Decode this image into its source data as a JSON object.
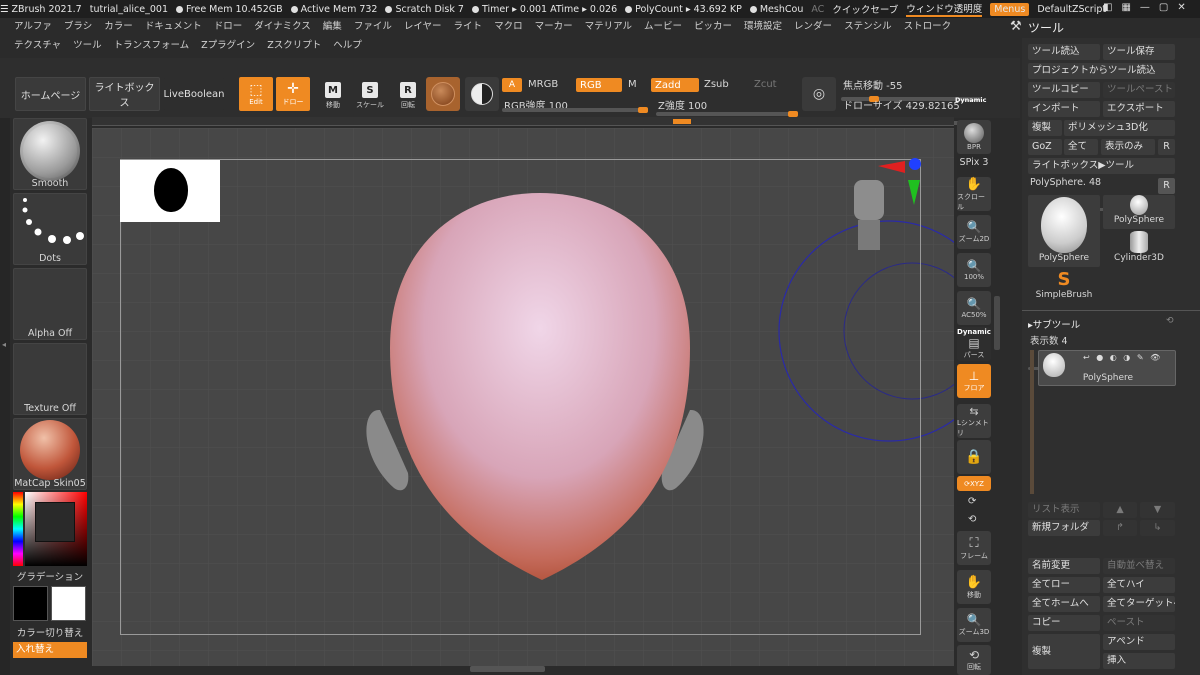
{
  "titlebar": {
    "app": "ZBrush 2021.7",
    "file": "tutrial_alice_001",
    "free_mem": "Free Mem 10.452GB",
    "active_mem": "Active Mem 732",
    "scratch": "Scratch Disk 7",
    "timer": "Timer ▸ 0.001 ATime ▸ 0.026",
    "polycount": "PolyCount ▸ 43.692 KP",
    "meshcount": "MeshCou",
    "ac": "AC",
    "quicksave": "クイックセーブ",
    "transparency": "ウィンドウ透明度",
    "menus": "Menus",
    "zscript": "DefaultZScript"
  },
  "menus_row1": [
    "アルファ",
    "ブラシ",
    "カラー",
    "ドキュメント",
    "ドロー",
    "ダイナミクス",
    "編集",
    "ファイル",
    "レイヤー",
    "ライト",
    "マクロ",
    "マーカー",
    "マテリアル",
    "ムービー",
    "ピッカー",
    "環境設定",
    "レンダー",
    "ステンシル",
    "ストローク"
  ],
  "menus_row2": [
    "テクスチャ",
    "ツール",
    "トランスフォーム",
    "Zプラグイン",
    "Zスクリプト",
    "ヘルプ"
  ],
  "shelf": {
    "home": "ホームページ",
    "lightbox": "ライトボックス",
    "liveboolean": "LiveBoolean",
    "edit": "Edit",
    "draw": "ドロー",
    "move": "移動",
    "scale": "スケール",
    "rotate": "回転",
    "a": "A",
    "mrgb": "MRGB",
    "rgb": "RGB",
    "m": "M",
    "zadd": "Zadd",
    "zsub": "Zsub",
    "zcut": "Zcut",
    "rgb_intensity": "RGB強度 100",
    "z_intensity": "Z強度 100",
    "focal_shift": "焦点移動 -55",
    "draw_size": "ドローサイズ 429.82165",
    "dynamic": "Dynamic"
  },
  "left_tray": {
    "brush": "Smooth",
    "stroke": "Dots",
    "alpha": "Alpha Off",
    "texture": "Texture Off",
    "material": "MatCap Skin05",
    "gradient": "グラデーション",
    "switch_color": "カラー切り替え",
    "swap": "入れ替え"
  },
  "right_column": {
    "bpr": "BPR",
    "spix": "SPix 3",
    "scroll": "スクロール",
    "zoom2d": "ズーム2D",
    "pct100": "100%",
    "ac50": "AC50%",
    "dynamic": "Dynamic",
    "perspective": "パース",
    "floor": "フロア",
    "symmetry_local": "Lシンメトリ",
    "xyz": "XYZ",
    "frame": "フレーム",
    "move": "移動",
    "zoom3d": "ズーム3D",
    "rotate": "回転"
  },
  "tool_panel": {
    "title": "ツール",
    "load": "ツール読込",
    "save": "ツール保存",
    "load_project": "プロジェクトからツール読込",
    "copy": "ツールコピー",
    "paste": "ツールペースト",
    "import": "インポート",
    "export": "エクスポート",
    "clone": "複製",
    "polymesh": "ポリメッシュ3D化",
    "goz": "GoZ",
    "all": "全て",
    "visible": "表示のみ",
    "r": "R",
    "lightbox_tool": "ライトボックス▶ツール",
    "polysphere_value": "PolySphere. 48",
    "thumb_main": "PolySphere",
    "thumb_polysphere": "PolySphere",
    "thumb_cylinder": "Cylinder3D",
    "thumb_simplebrush": "SimpleBrush"
  },
  "subtool_panel": {
    "title": "▸サブツール",
    "count": "表示数 4",
    "item": "PolySphere",
    "list_view": "リスト表示",
    "new_folder": "新規フォルダ",
    "rename": "名前変更",
    "autosort": "自動並べ替え",
    "all_low": "全てロー",
    "all_high": "全てハイ",
    "all_home": "全てホームへ",
    "all_target": "全てターゲットへ",
    "copy": "コピー",
    "paste": "ペースト",
    "duplicate": "複製",
    "append": "アペンド",
    "insert": "挿入"
  },
  "colors": {
    "accent": "#ef8a22",
    "panel": "#2f2f2f",
    "canvas": "#474747"
  }
}
